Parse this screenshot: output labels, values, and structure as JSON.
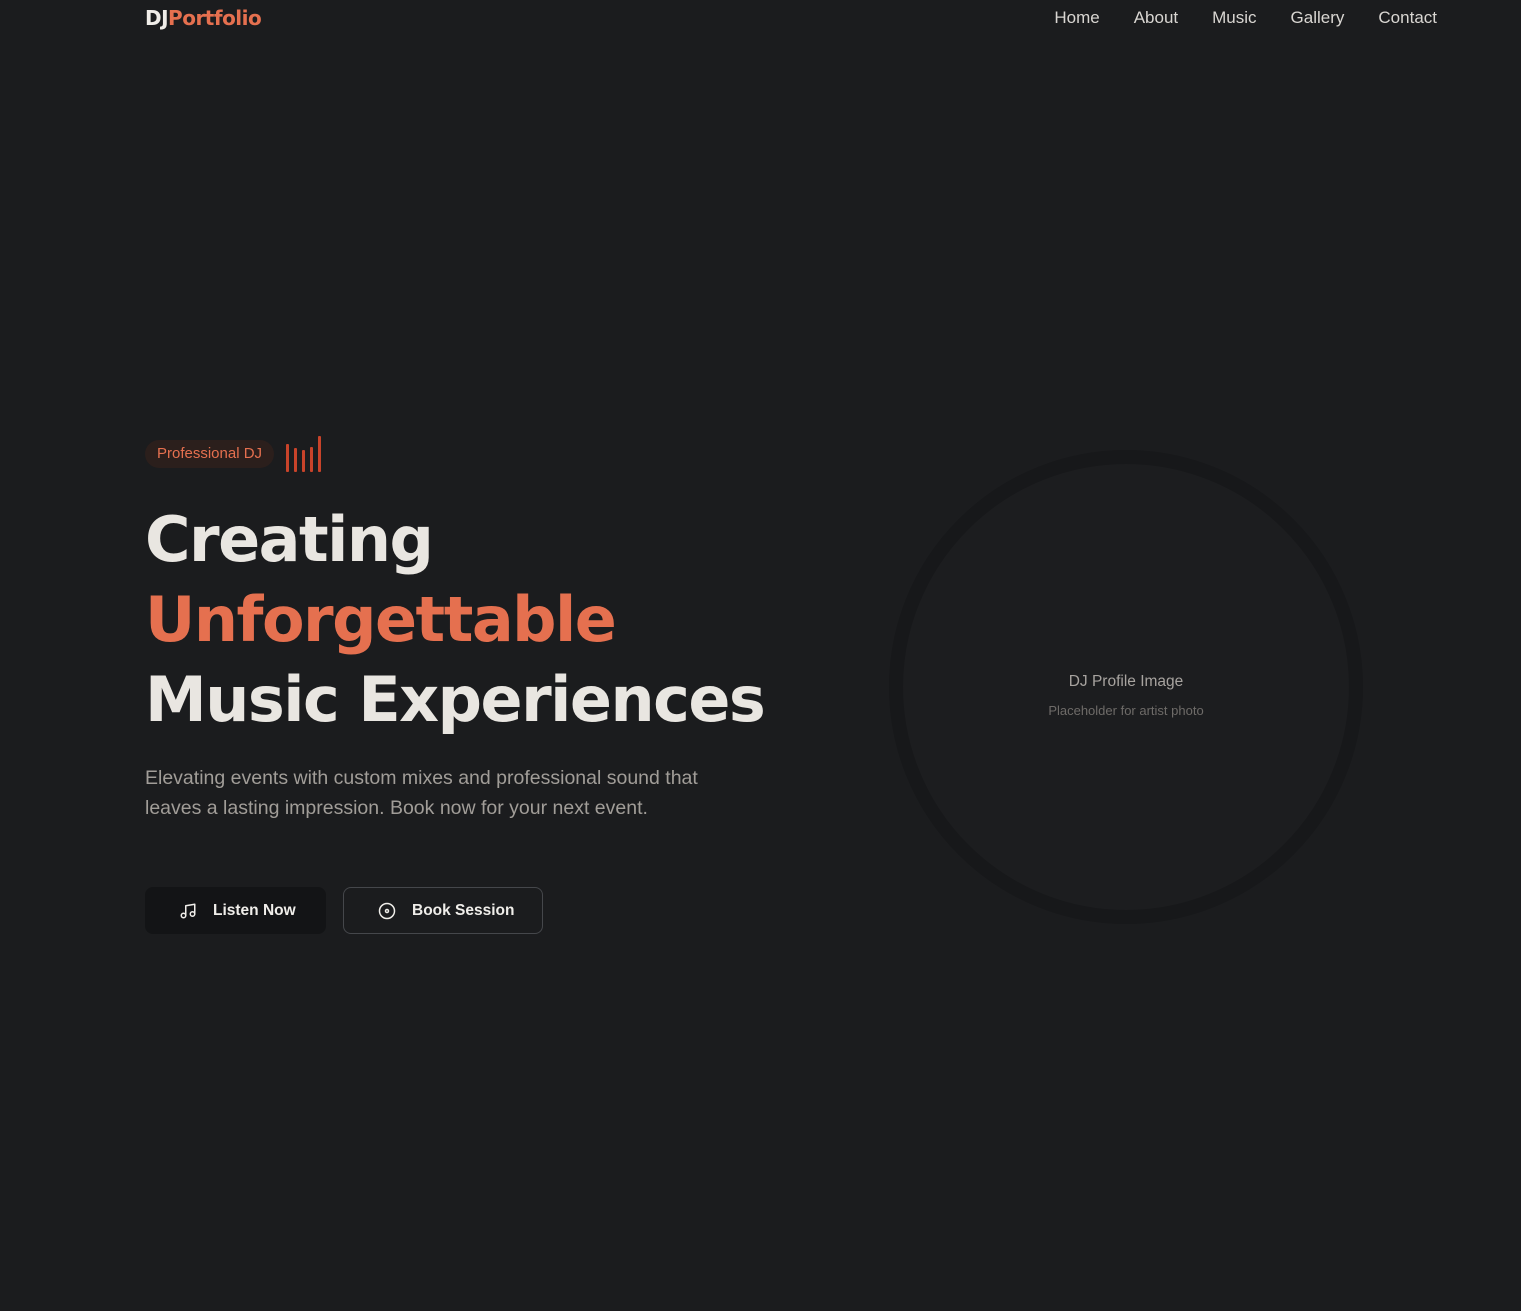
{
  "nav": {
    "logo_part1": "DJ",
    "logo_part2": "Portfolio",
    "links": [
      "Home",
      "About",
      "Music",
      "Gallery",
      "Contact"
    ]
  },
  "hero": {
    "badge": "Professional DJ",
    "headline_line1": "Creating",
    "headline_line2": "Unforgettable",
    "headline_line3": "Music Experiences",
    "lead": "Elevating events with custom mixes and professional sound that leaves a lasting impression. Book now for your next event.",
    "primary_button": "Listen Now",
    "secondary_button": "Book Session"
  },
  "profile": {
    "title": "DJ Profile Image",
    "subtitle": "Placeholder for artist photo"
  },
  "colors": {
    "accent": "#e5704f",
    "background": "#1b1c1e"
  },
  "icons": {
    "primary_button": "music-note-icon",
    "secondary_button": "disc-icon",
    "badge_decoration": "equalizer-bars-icon"
  }
}
